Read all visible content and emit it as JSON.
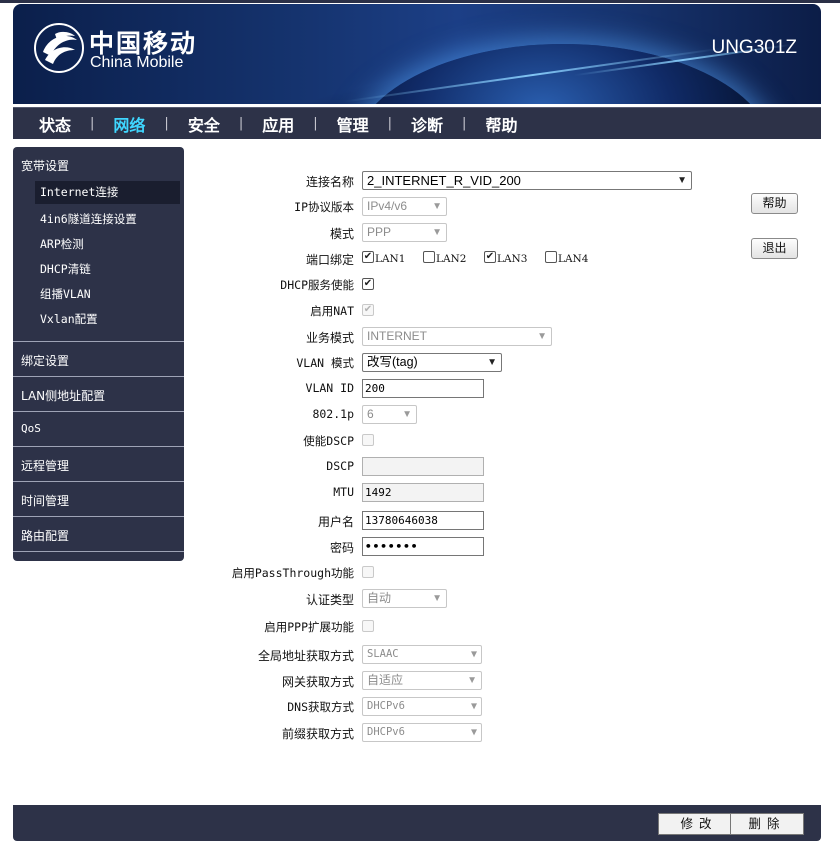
{
  "header": {
    "brand_cn": "中国移动",
    "brand_en": "China Mobile",
    "model": "UNG301Z"
  },
  "nav": {
    "items": [
      "状态",
      "网络",
      "安全",
      "应用",
      "管理",
      "诊断",
      "帮助"
    ],
    "active": "网络",
    "separator": "|"
  },
  "sidebar": {
    "group_broadband": "宽带设置",
    "sub_items": [
      "Internet连接",
      "4in6隧道连接设置",
      "ARP检测",
      "DHCP清链",
      "组播VLAN",
      "Vxlan配置"
    ],
    "active_sub": "Internet连接",
    "groups": [
      "绑定设置",
      "LAN侧地址配置",
      "QoS",
      "远程管理",
      "时间管理",
      "路由配置"
    ]
  },
  "form": {
    "conn_name_label": "连接名称",
    "conn_name_value": "2_INTERNET_R_VID_200",
    "ip_protocol_label": "IP协议版本",
    "ip_protocol_value": "IPv4/v6",
    "mode_label": "模式",
    "mode_value": "PPP",
    "port_bind_label": "端口绑定",
    "ports": [
      {
        "label": "LAN1",
        "checked": true
      },
      {
        "label": "LAN2",
        "checked": false
      },
      {
        "label": "LAN3",
        "checked": true
      },
      {
        "label": "LAN4",
        "checked": false
      }
    ],
    "dhcp_label": "DHCP服务使能",
    "dhcp_checked": true,
    "nat_label": "启用NAT",
    "nat_checked": true,
    "service_mode_label": "业务模式",
    "service_mode_value": "INTERNET",
    "vlan_mode_label": "VLAN 模式",
    "vlan_mode_value": "改写(tag)",
    "vlan_id_label": "VLAN ID",
    "vlan_id_value": "200",
    "p8021_label": "802.1p",
    "p8021_value": "6",
    "dscp_enable_label": "使能DSCP",
    "dscp_label": "DSCP",
    "dscp_value": "",
    "mtu_label": "MTU",
    "mtu_value": "1492",
    "username_label": "用户名",
    "username_value": "13780646038",
    "password_label": "密码",
    "password_value": "•••••••",
    "passthrough_label": "启用PassThrough功能",
    "auth_type_label": "认证类型",
    "auth_type_value": "自动",
    "ppp_ext_label": "启用PPP扩展功能",
    "global_addr_label": "全局地址获取方式",
    "global_addr_value": "SLAAC",
    "gateway_label": "网关获取方式",
    "gateway_value": "自适应",
    "dns_label": "DNS获取方式",
    "dns_value": "DHCPv6",
    "prefix_label": "前缀获取方式",
    "prefix_value": "DHCPv6"
  },
  "side_buttons": {
    "help": "帮助",
    "logout": "退出"
  },
  "footer": {
    "modify": "修改",
    "delete": "删除"
  },
  "icons": {
    "dropdown": "chevron-down-icon",
    "check": "check-icon",
    "logo": "china-mobile-logo"
  },
  "colors": {
    "nav_bg": "#2d3248",
    "nav_active": "#3fd6ff",
    "header_blue": "#15336e"
  }
}
